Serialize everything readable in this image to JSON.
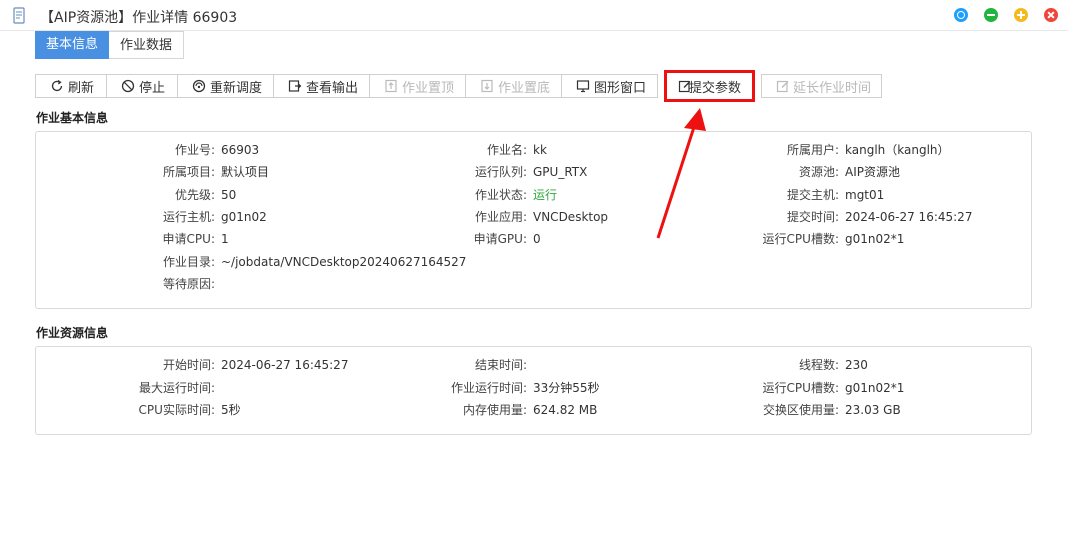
{
  "window": {
    "title": "【AIP资源池】作业详情 66903"
  },
  "tabs": [
    {
      "label": "基本信息",
      "active": true
    },
    {
      "label": "作业数据",
      "active": false
    }
  ],
  "toolbar": {
    "refresh": "刷新",
    "stop": "停止",
    "reschedule": "重新调度",
    "view_output": "查看输出",
    "job_top": "作业置顶",
    "job_bottom": "作业置底",
    "graphic_window": "图形窗口",
    "submit_params": "提交参数",
    "extend_time": "延长作业时间"
  },
  "basic": {
    "section_title": "作业基本信息",
    "job_id_label": "作业号:",
    "job_id": "66903",
    "job_name_label": "作业名:",
    "job_name": "kk",
    "owner_label": "所属用户:",
    "owner": "kanglh（kanglh）",
    "project_label": "所属项目:",
    "project": "默认项目",
    "queue_label": "运行队列:",
    "queue": "GPU_RTX",
    "pool_label": "资源池:",
    "pool": "AIP资源池",
    "priority_label": "优先级:",
    "priority": "50",
    "status_label": "作业状态:",
    "status": "运行",
    "submit_host_label": "提交主机:",
    "submit_host": "mgt01",
    "run_host_label": "运行主机:",
    "run_host": "g01n02",
    "app_label": "作业应用:",
    "app": "VNCDesktop",
    "submit_time_label": "提交时间:",
    "submit_time": "2024-06-27 16:45:27",
    "req_cpu_label": "申请CPU:",
    "req_cpu": "1",
    "req_gpu_label": "申请GPU:",
    "req_gpu": "0",
    "cpu_slots_label": "运行CPU槽数:",
    "cpu_slots": "g01n02*1",
    "job_dir_label": "作业目录:",
    "job_dir": "~/jobdata/VNCDesktop20240627164527",
    "wait_reason_label": "等待原因:",
    "wait_reason": ""
  },
  "resource": {
    "section_title": "作业资源信息",
    "start_time_label": "开始时间:",
    "start_time": "2024-06-27 16:45:27",
    "end_time_label": "结束时间:",
    "end_time": "",
    "threads_label": "线程数:",
    "threads": "230",
    "max_run_label": "最大运行时间:",
    "max_run": "",
    "run_time_label": "作业运行时间:",
    "run_time": "33分钟55秒",
    "cpu_slots_label": "运行CPU槽数:",
    "cpu_slots": "g01n02*1",
    "cpu_actual_label": "CPU实际时间:",
    "cpu_actual": "5秒",
    "mem_label": "内存使用量:",
    "mem": "624.82 MB",
    "swap_label": "交换区使用量:",
    "swap": "23.03 GB"
  },
  "colors": {
    "tab_active": "#4a90e2",
    "highlight_box": "#ee1111",
    "status_running": "#2eaa3c"
  }
}
